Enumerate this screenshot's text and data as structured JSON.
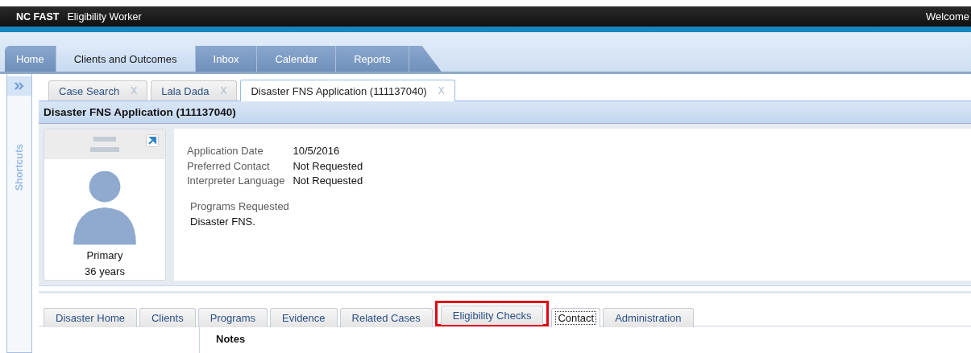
{
  "app": {
    "brand": "NC FAST",
    "role": "Eligibility Worker",
    "welcome": "Welcome"
  },
  "main_tabs": [
    {
      "label": "Home",
      "selected": false
    },
    {
      "label": "Clients and Outcomes",
      "selected": true
    },
    {
      "label": "Inbox",
      "selected": false
    },
    {
      "label": "Calendar",
      "selected": false
    },
    {
      "label": "Reports",
      "selected": false
    }
  ],
  "sidebar": {
    "label": "Shortcuts"
  },
  "page_tabs": [
    {
      "label": "Case Search",
      "close": "X",
      "selected": false
    },
    {
      "label": "Lala Dada",
      "close": "X",
      "selected": false
    },
    {
      "label": "Disaster FNS Application (111137040)",
      "close": "X",
      "selected": true
    }
  ],
  "page_title": "Disaster FNS Application (111137040)",
  "person": {
    "role": "Primary",
    "age": "36 years"
  },
  "details": [
    {
      "label": "Application Date",
      "value": "10/5/2016"
    },
    {
      "label": "Preferred Contact",
      "value": "Not Requested"
    },
    {
      "label": "Interpreter Language",
      "value": "Not Requested"
    }
  ],
  "programs": {
    "label": "Programs Requested",
    "value": "Disaster FNS."
  },
  "case_tabs": [
    {
      "label": "Disaster Home",
      "selected": false,
      "highlighted": false
    },
    {
      "label": "Clients",
      "selected": false,
      "highlighted": false
    },
    {
      "label": "Programs",
      "selected": false,
      "highlighted": false
    },
    {
      "label": "Evidence",
      "selected": false,
      "highlighted": false
    },
    {
      "label": "Related Cases",
      "selected": false,
      "highlighted": false
    },
    {
      "label": "Eligibility Checks",
      "selected": false,
      "highlighted": true
    },
    {
      "label": "Contact",
      "selected": true,
      "highlighted": false
    },
    {
      "label": "Administration",
      "selected": false,
      "highlighted": false
    }
  ],
  "section_title": "Notes"
}
